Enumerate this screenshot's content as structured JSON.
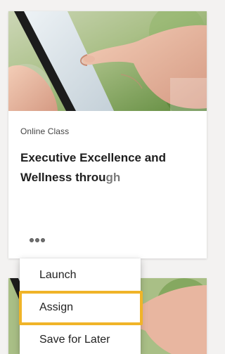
{
  "card": {
    "eyebrow": "Online Class",
    "title_main": "Executive Excellence and Wellness throu",
    "title_fade": "gh"
  },
  "menu": {
    "items": [
      {
        "label": "Launch"
      },
      {
        "label": "Assign",
        "highlighted": true
      },
      {
        "label": "Save for Later"
      }
    ]
  },
  "colors": {
    "highlight": "#f0b428",
    "page_bg": "#f3f2f1",
    "title": "#1f1f1f"
  },
  "icons": {
    "more": "more-horizontal-icon"
  }
}
